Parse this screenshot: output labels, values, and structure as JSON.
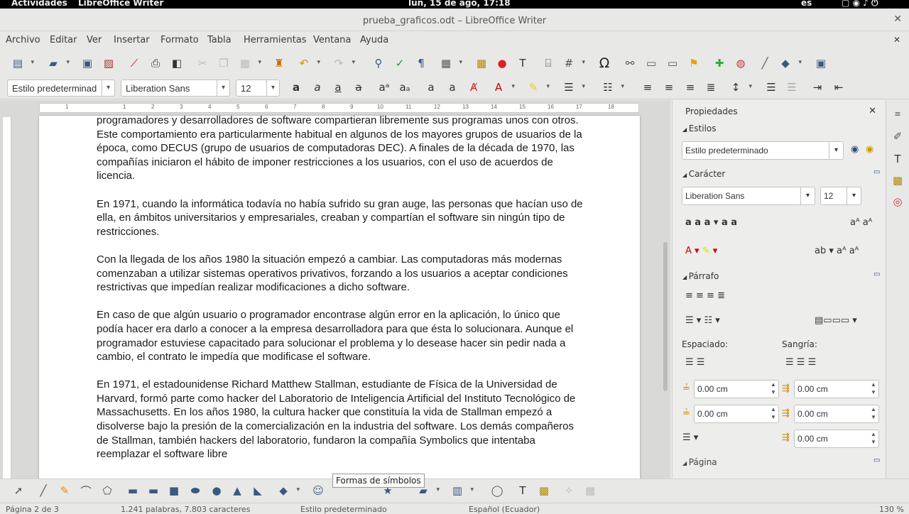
{
  "topbar": {
    "activities": "Actividades",
    "app": "LibreOffice Writer",
    "clock": "lun, 15 de ago, 17:18",
    "lang": "es"
  },
  "window": {
    "title": "prueba_graficos.odt – LibreOffice Writer",
    "close": "✕"
  },
  "menu": [
    "Archivo",
    "Editar",
    "Ver",
    "Insertar",
    "Formato",
    "Tabla",
    "Herramientas",
    "Ventana",
    "Ayuda"
  ],
  "menu_collapse": "✕",
  "format": {
    "style": "Estilo predeterminad",
    "font": "Liberation Sans",
    "size": "12"
  },
  "ruler_ticks": [
    "1",
    "1",
    "2",
    "3",
    "4",
    "5",
    "6",
    "7",
    "8",
    "9",
    "10",
    "11",
    "12",
    "13",
    "14",
    "15",
    "16",
    "17",
    "18"
  ],
  "document": {
    "paragraphs": [
      "programadores y desarrolladores de software compartieran libremente sus programas unos con otros. Este comportamiento era particularmente habitual en algunos de los mayores grupos de usuarios de la época, como DECUS (grupo de usuarios de computadoras DEC). A finales de la década de 1970, las compañías iniciaron el hábito de imponer restricciones a los usuarios, con el uso de acuerdos de licencia.",
      "En 1971, cuando la informática todavía no había sufrido su gran auge, las personas que hacían uso de ella, en ámbitos universitarios y empresariales, creaban y compartían el software sin ningún tipo de restricciones.",
      "Con la llegada de los años 1980 la situación empezó a cambiar. Las computadoras más modernas comenzaban a utilizar sistemas operativos privativos, forzando a los usuarios a aceptar condiciones restrictivas que impedían realizar modificaciones a dicho software.",
      "En caso de que algún usuario o programador encontrase algún error en la aplicación, lo único que podía hacer era darlo a conocer a la empresa desarrolladora para que ésta lo solucionara. Aunque el programador estuviese capacitado para solucionar el problema y lo desease hacer sin pedir nada a cambio, el contrato le impedía que modificase el software.",
      "En 1971, el estadounidense Richard Matthew Stallman, estudiante de Física de la Universidad de Harvard, formó parte como hacker del Laboratorio de Inteligencia Artificial del Instituto Tecnológico de Massachusetts. En los años 1980, la cultura hacker que constituía la vida de Stallman empezó a disolverse bajo la presión de la comercialización en la industria del software. Los demás compañeros de Stallman, también hackers del laboratorio, fundaron la compañía Symbolics que intentaba reemplazar el software libre"
    ]
  },
  "sidebar": {
    "title": "Propiedades",
    "close": "✕",
    "styles_section": "Estilos",
    "style_value": "Estilo predeterminado",
    "char_section": "Carácter",
    "font_value": "Liberation Sans",
    "size_value": "12",
    "para_section": "Párrafo",
    "spacing_label": "Espaciado:",
    "indent_label": "Sangría:",
    "spacing_above": "0.00 cm",
    "spacing_below": "0.00 cm",
    "indent_before": "0.00 cm",
    "indent_after": "0.00 cm",
    "indent_first": "0.00 cm",
    "page_section": "Página"
  },
  "tooltip": "Formas de símbolos",
  "status": {
    "page": "Página 2 de 3",
    "words": "1.241 palabras, 7.803 caracteres",
    "style": "Estilo predeterminado",
    "lang": "Español (Ecuador)",
    "zoom": "130 %"
  }
}
